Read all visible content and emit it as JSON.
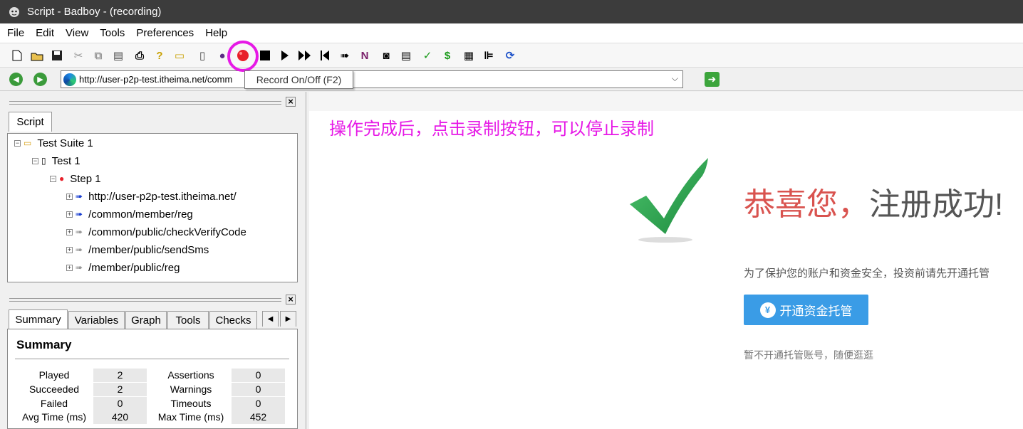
{
  "window": {
    "title": "Script - Badboy - (recording)"
  },
  "menu": [
    "File",
    "Edit",
    "View",
    "Tools",
    "Preferences",
    "Help"
  ],
  "toolbar": {
    "tooltip": "Record On/Off (F2)"
  },
  "address": {
    "url": "http://user-p2p-test.itheima.net/comm"
  },
  "script_panel": {
    "tab": "Script",
    "tree": [
      {
        "label": "Test Suite 1"
      },
      {
        "label": "Test 1"
      },
      {
        "label": "Step 1"
      },
      {
        "label": "http://user-p2p-test.itheima.net/"
      },
      {
        "label": "/common/member/reg"
      },
      {
        "label": "/common/public/checkVerifyCode"
      },
      {
        "label": "/member/public/sendSms"
      },
      {
        "label": "/member/public/reg"
      }
    ]
  },
  "bottom_panel": {
    "tabs": [
      "Summary",
      "Variables",
      "Graph",
      "Tools",
      "Checks"
    ],
    "heading": "Summary",
    "stats": {
      "played_label": "Played",
      "played": "2",
      "succeeded_label": "Succeeded",
      "succeeded": "2",
      "failed_label": "Failed",
      "failed": "0",
      "avg_label": "Avg Time (ms)",
      "avg": "420",
      "assertions_label": "Assertions",
      "assertions": "0",
      "warnings_label": "Warnings",
      "warnings": "0",
      "timeouts_label": "Timeouts",
      "timeouts": "0",
      "max_label": "Max Time (ms)",
      "max": "452"
    }
  },
  "content": {
    "annotation": "操作完成后，点击录制按钮，可以停止录制",
    "congrats_red": "恭喜您，",
    "congrats_gray": "注册成功!",
    "protect_text": "为了保护您的账户和资金安全，投资前请先开通托管",
    "open_button": "开通资金托管",
    "skip_text": "暂不开通托管账号，随便逛逛"
  },
  "colors": {
    "annotation": "#e619e6",
    "congrats": "#d9534f",
    "button": "#3a9ce6",
    "check": "#2e9e4f"
  }
}
